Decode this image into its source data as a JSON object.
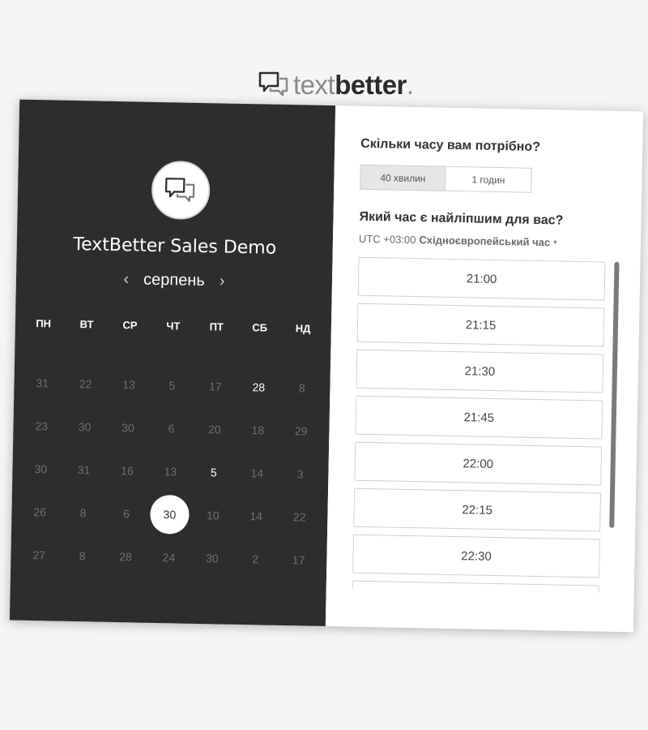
{
  "logo": {
    "light": "text",
    "dark": "better",
    "mark": "."
  },
  "event": {
    "title": "TextBetter Sales Demo"
  },
  "calendar": {
    "month": "серпень",
    "prev_label": "‹",
    "next_label": "›",
    "weekdays": [
      "ПН",
      "ВТ",
      "СР",
      "ЧТ",
      "ПТ",
      "СБ",
      "НД"
    ],
    "weeks": [
      [
        {
          "d": "31",
          "s": "off"
        },
        {
          "d": "22",
          "s": "off"
        },
        {
          "d": "13",
          "s": "off"
        },
        {
          "d": "5",
          "s": "off"
        },
        {
          "d": "17",
          "s": "off"
        },
        {
          "d": "28",
          "s": "available"
        },
        {
          "d": "8",
          "s": "off"
        }
      ],
      [
        {
          "d": "23",
          "s": "off"
        },
        {
          "d": "30",
          "s": "off"
        },
        {
          "d": "30",
          "s": "off"
        },
        {
          "d": "6",
          "s": "off"
        },
        {
          "d": "20",
          "s": "off"
        },
        {
          "d": "18",
          "s": "off"
        },
        {
          "d": "29",
          "s": "off"
        }
      ],
      [
        {
          "d": "30",
          "s": "off"
        },
        {
          "d": "31",
          "s": "off"
        },
        {
          "d": "16",
          "s": "off"
        },
        {
          "d": "13",
          "s": "off"
        },
        {
          "d": "5",
          "s": "available"
        },
        {
          "d": "14",
          "s": "off"
        },
        {
          "d": "3",
          "s": "off"
        }
      ],
      [
        {
          "d": "26",
          "s": "off"
        },
        {
          "d": "8",
          "s": "off"
        },
        {
          "d": "6",
          "s": "off"
        },
        {
          "d": "30",
          "s": "selected"
        },
        {
          "d": "10",
          "s": "off"
        },
        {
          "d": "14",
          "s": "off"
        },
        {
          "d": "22",
          "s": "off"
        }
      ],
      [
        {
          "d": "27",
          "s": "off"
        },
        {
          "d": "8",
          "s": "off"
        },
        {
          "d": "28",
          "s": "off"
        },
        {
          "d": "24",
          "s": "off"
        },
        {
          "d": "30",
          "s": "off"
        },
        {
          "d": "2",
          "s": "off"
        },
        {
          "d": "17",
          "s": "off"
        }
      ]
    ]
  },
  "booking": {
    "duration_question": "Скільки часу вам потрібно?",
    "durations": [
      {
        "label": "40 хвилин",
        "active": true
      },
      {
        "label": "1 годин",
        "active": false
      }
    ],
    "time_question": "Який час є найліпшим для вас?",
    "timezone_offset": "UTC +03:00",
    "timezone_name": "Східноєвропейський час",
    "timezone_caret": "▾",
    "slots": [
      "21:00",
      "21:15",
      "21:30",
      "21:45",
      "22:00",
      "22:15",
      "22:30",
      ""
    ]
  }
}
